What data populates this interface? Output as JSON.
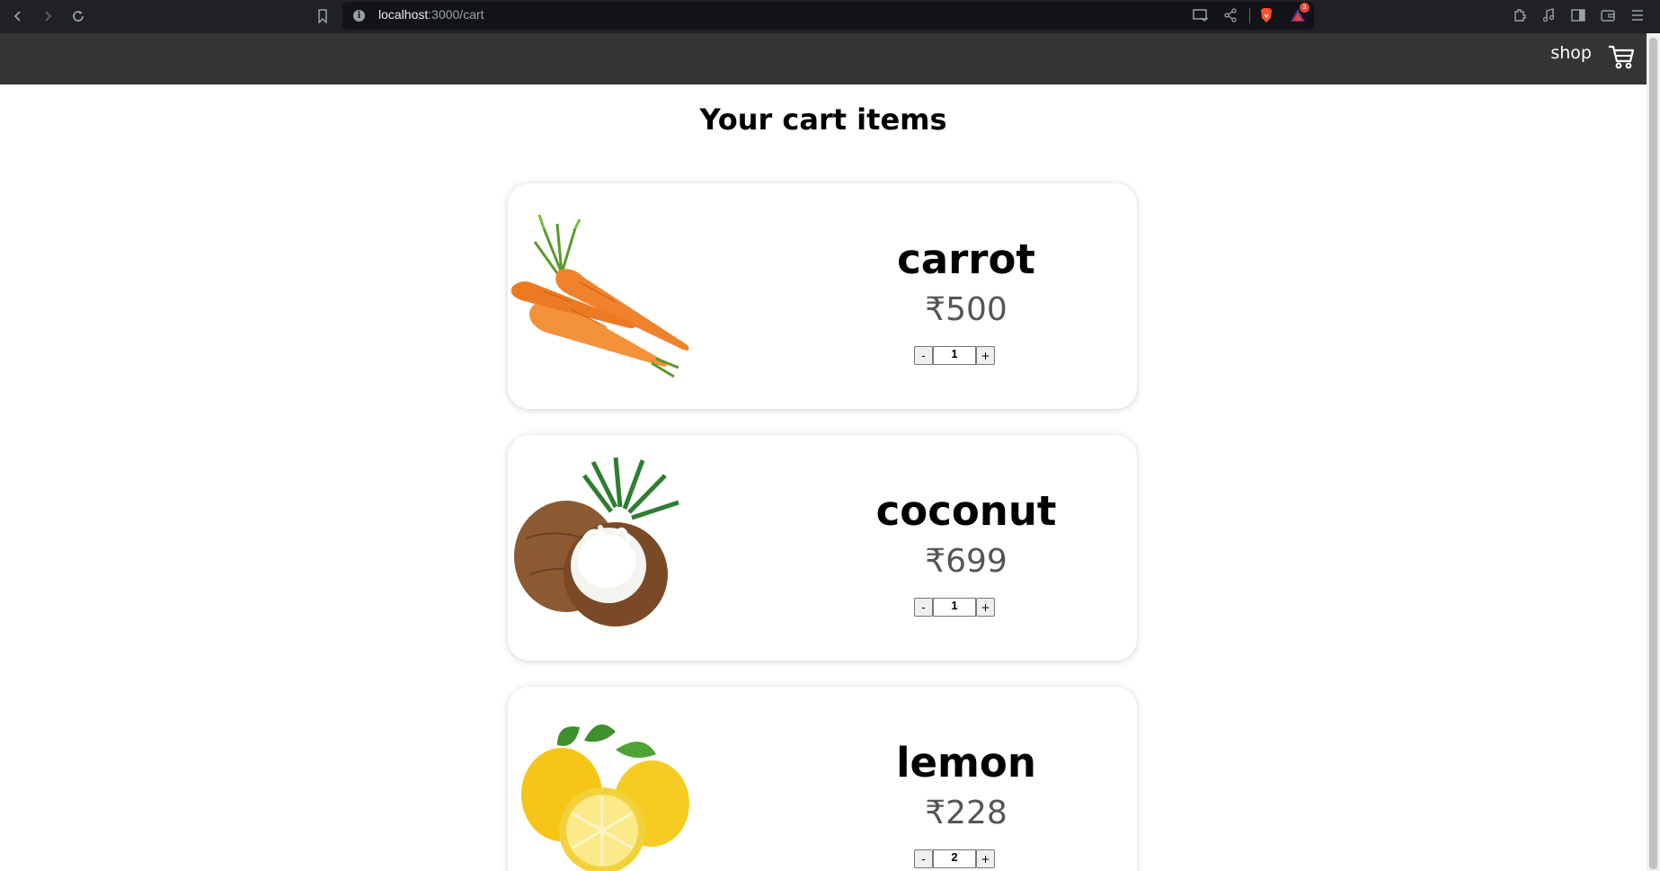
{
  "browser": {
    "url_host": "localhost",
    "url_path": ":3000/cart",
    "notification_count": "3"
  },
  "header": {
    "shop_label": "shop"
  },
  "page": {
    "title": "Your cart items"
  },
  "cart": {
    "items": [
      {
        "name": "carrot",
        "price": "₹500",
        "qty": "1",
        "dec_label": "-",
        "inc_label": "+"
      },
      {
        "name": "coconut",
        "price": "₹699",
        "qty": "1",
        "dec_label": "-",
        "inc_label": "+"
      },
      {
        "name": "lemon",
        "price": "₹228",
        "qty": "2",
        "dec_label": "-",
        "inc_label": "+"
      }
    ]
  },
  "colors": {
    "header_bg": "#343434",
    "browser_bg": "#202124",
    "price_text": "#555555"
  }
}
